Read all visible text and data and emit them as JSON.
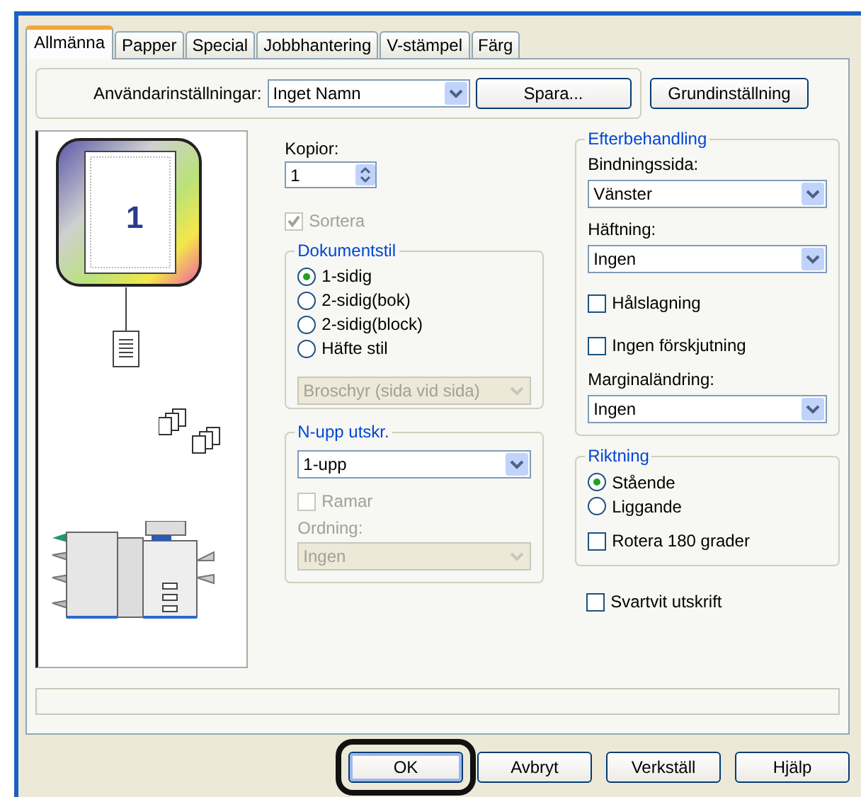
{
  "tabs": [
    {
      "label": "Allmänna",
      "selected": true
    },
    {
      "label": "Papper",
      "selected": false
    },
    {
      "label": "Special",
      "selected": false
    },
    {
      "label": "Jobbhantering",
      "selected": false
    },
    {
      "label": "V-stämpel",
      "selected": false
    },
    {
      "label": "Färg",
      "selected": false
    }
  ],
  "user_settings": {
    "label": "Användarinställningar:",
    "value": "Inget Namn",
    "save_button": "Spara...",
    "default_button": "Grundinställning"
  },
  "preview": {
    "page_number": "1"
  },
  "copies": {
    "label": "Kopior:",
    "value": "1"
  },
  "collate": {
    "label": "Sortera",
    "checked": true,
    "disabled": true
  },
  "document_style": {
    "title": "Dokumentstil",
    "options": [
      {
        "label": "1-sidig",
        "selected": true
      },
      {
        "label": "2-sidig(bok)",
        "selected": false
      },
      {
        "label": "2-sidig(block)",
        "selected": false
      },
      {
        "label": "Häfte stil",
        "selected": false
      }
    ],
    "booklet": {
      "value": "Broschyr (sida vid sida)",
      "disabled": true
    }
  },
  "n_up": {
    "title": "N-upp utskr.",
    "value": "1-upp",
    "border": {
      "label": "Ramar",
      "checked": false,
      "disabled": true
    },
    "order_label": "Ordning:",
    "order_label_disabled": true,
    "order": {
      "value": "Ingen",
      "disabled": true
    }
  },
  "finishing": {
    "title": "Efterbehandling",
    "binding_label": "Bindningssida:",
    "binding": "Vänster",
    "staple_label": "Häftning:",
    "staple": "Ingen",
    "hole_punch": {
      "label": "Hålslagning",
      "checked": false
    },
    "no_offset": {
      "label": "Ingen förskjutning",
      "checked": false
    },
    "margin_label": "Marginaländring:",
    "margin": "Ingen"
  },
  "orientation": {
    "title": "Riktning",
    "options": [
      {
        "label": "Stående",
        "selected": true
      },
      {
        "label": "Liggande",
        "selected": false
      }
    ],
    "rotate": {
      "label": "Rotera 180 grader",
      "checked": false
    }
  },
  "black_white": {
    "label": "Svartvit utskrift",
    "checked": false
  },
  "buttons": [
    {
      "label": "OK",
      "highlighted": true
    },
    {
      "label": "Avbryt",
      "highlighted": false
    },
    {
      "label": "Verkställ",
      "highlighted": false
    },
    {
      "label": "Hjälp",
      "highlighted": false
    }
  ]
}
